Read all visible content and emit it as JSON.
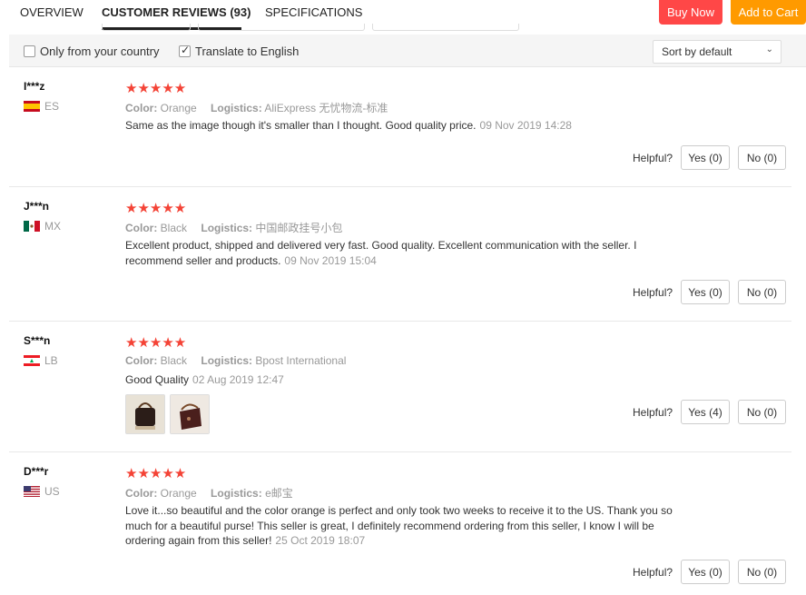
{
  "tabs": [
    {
      "label": "OVERVIEW"
    },
    {
      "label": "CUSTOMER REVIEWS (93)"
    },
    {
      "label": "SPECIFICATIONS"
    }
  ],
  "actions": {
    "buy_now": "Buy Now",
    "add_to_cart": "Add to Cart"
  },
  "colors": {
    "buy_now": "#ff4747",
    "add_to_cart": "#ff9a00",
    "stars": "#f44336"
  },
  "filters": {
    "only_country": {
      "label": "Only from your country",
      "checked": false
    },
    "translate": {
      "label": "Translate to English",
      "checked": true
    },
    "sort": {
      "value": "Sort by default"
    }
  },
  "reviews": [
    {
      "user": "I***z",
      "country": "ES",
      "stars": "★★★★★",
      "rating": 5,
      "color_label": "Color:",
      "color_value": "Orange",
      "logistics_label": "Logistics:",
      "logistics_value": "AliExpress 无忧物流-标准",
      "text": "Same as the image though it's smaller than I thought. Good quality price.",
      "date": "09 Nov 2019 14:28",
      "helpful_label": "Helpful?",
      "yes": "Yes (0)",
      "no": "No (0)"
    },
    {
      "user": "J***n",
      "country": "MX",
      "stars": "★★★★★",
      "rating": 5,
      "color_label": "Color:",
      "color_value": "Black",
      "logistics_label": "Logistics:",
      "logistics_value": "中国邮政挂号小包",
      "text": "Excellent product, shipped and delivered very fast. Good quality. Excellent communication with the seller. I recommend seller and products.",
      "date": "09 Nov 2019 15:04",
      "helpful_label": "Helpful?",
      "yes": "Yes (0)",
      "no": "No (0)"
    },
    {
      "user": "S***n",
      "country": "LB",
      "stars": "★★★★★",
      "rating": 5,
      "color_label": "Color:",
      "color_value": "Black",
      "logistics_label": "Logistics:",
      "logistics_value": "Bpost International",
      "text": "Good Quality",
      "date": "02 Aug 2019 12:47",
      "photos": [
        "bag-photo",
        "bag-photo"
      ],
      "helpful_label": "Helpful?",
      "yes": "Yes (4)",
      "no": "No (0)"
    },
    {
      "user": "D***r",
      "country": "US",
      "stars": "★★★★★",
      "rating": 5,
      "color_label": "Color:",
      "color_value": "Orange",
      "logistics_label": "Logistics:",
      "logistics_value": "e邮宝",
      "text": "Love it...so beautiful and the color orange is perfect and only took two weeks to receive it to the US. Thank you so much for a beautiful purse! This seller is great, I definitely recommend ordering from this seller, I know I will be ordering again from this seller!",
      "date": "25 Oct 2019 18:07",
      "helpful_label": "Helpful?",
      "yes": "Yes (0)",
      "no": "No (0)"
    }
  ]
}
